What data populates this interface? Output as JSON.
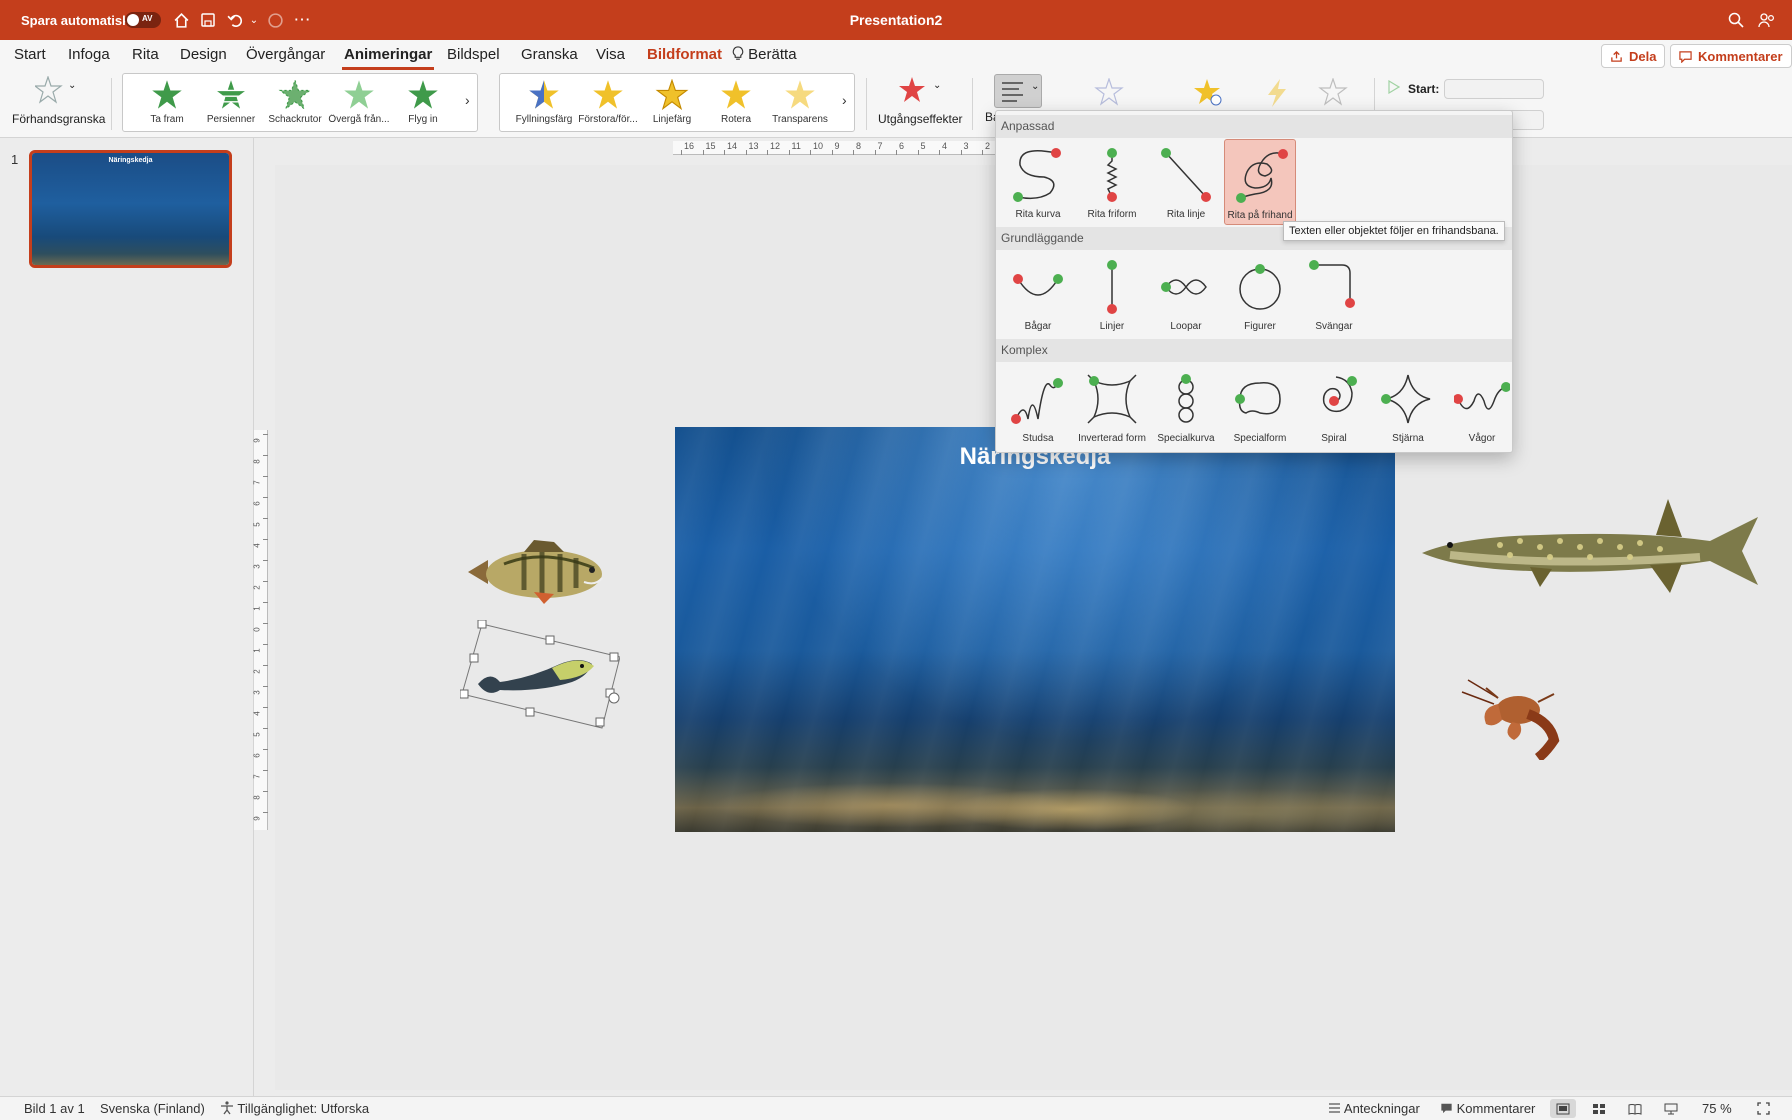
{
  "titlebar": {
    "autosave_label": "Spara automatiskt",
    "toggle_state": "AV",
    "title": "Presentation2"
  },
  "menu": {
    "tabs": [
      "Start",
      "Infoga",
      "Rita",
      "Design",
      "Övergångar",
      "Animeringar",
      "Bildspel",
      "Granska",
      "Visa",
      "Bildformat",
      "Berätta"
    ],
    "active_tab": "Animeringar",
    "contextual_tab": "Bildformat",
    "share_label": "Dela",
    "comments_label": "Kommentarer"
  },
  "ribbon": {
    "preview_label": "Förhandsgranska",
    "entrance": [
      "Ta fram",
      "Persienner",
      "Schackrutor",
      "Övergå från...",
      "Flyg in"
    ],
    "emphasis": [
      "Fyllningsfärg",
      "Förstora/för...",
      "Linjefärg",
      "Rotera",
      "Transparens"
    ],
    "exit_label": "Utgångseffekter",
    "paths_label_partial": "Ba",
    "start_label": "Start:"
  },
  "dropdown": {
    "sections": [
      {
        "title": "Anpassad",
        "items": [
          "Rita kurva",
          "Rita friform",
          "Rita linje",
          "Rita på frihand"
        ]
      },
      {
        "title": "Grundläggande",
        "items": [
          "Bågar",
          "Linjer",
          "Loopar",
          "Figurer",
          "Svängar"
        ]
      },
      {
        "title": "Komplex",
        "items": [
          "Studsa",
          "Inverterad form",
          "Specialkurva",
          "Specialform",
          "Spiral",
          "Stjärna",
          "Vågor"
        ]
      }
    ],
    "selected_item": "Rita på frihand",
    "tooltip": "Texten eller objektet följer en frihandsbana."
  },
  "thumbnails": {
    "slide_number": "1",
    "thumb_title": "Näringskedja"
  },
  "slide": {
    "title": "Näringskedja"
  },
  "ruler": {
    "h_labels": [
      "16",
      "15",
      "14",
      "13",
      "12",
      "11",
      "10",
      "9",
      "8",
      "7",
      "6",
      "5",
      "4",
      "3",
      "2"
    ],
    "v_labels": [
      "9",
      "8",
      "7",
      "6",
      "5",
      "4",
      "3",
      "2",
      "1",
      "0",
      "1",
      "2",
      "3",
      "4",
      "5",
      "6",
      "7",
      "8",
      "9"
    ]
  },
  "statusbar": {
    "slide_info": "Bild 1 av 1",
    "language": "Svenska (Finland)",
    "accessibility": "Tillgänglighet: Utforska",
    "notes": "Anteckningar",
    "comments": "Kommentarer",
    "zoom": "75 %"
  },
  "colors": {
    "accent": "#c43e1c",
    "path_start": "#4caf50",
    "path_end": "#e04444"
  }
}
